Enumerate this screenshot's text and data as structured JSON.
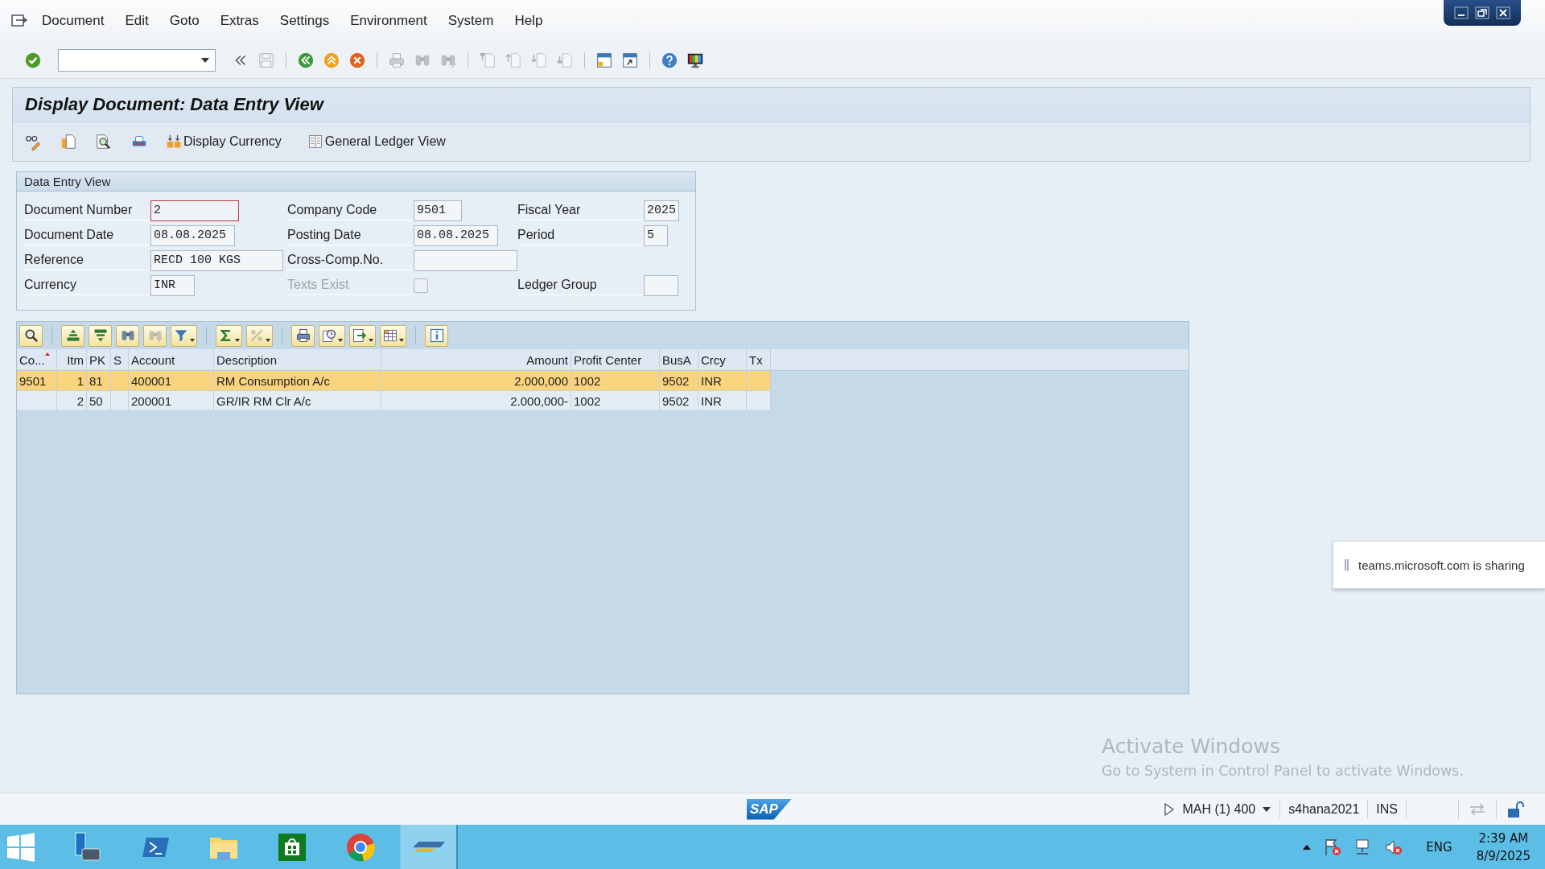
{
  "menu_bar": {
    "items": [
      "Document",
      "Edit",
      "Goto",
      "Extras",
      "Settings",
      "Environment",
      "System",
      "Help"
    ]
  },
  "toolbar": {
    "buttons": [
      {
        "disabled": false
      },
      {
        "disabled": false
      },
      {
        "disabled": true
      },
      {
        "disabled": false
      },
      {
        "disabled": false
      },
      {
        "disabled": false
      },
      {
        "disabled": true
      },
      {
        "disabled": true
      },
      {
        "disabled": true
      },
      {
        "disabled": true
      },
      {
        "disabled": true
      },
      {
        "disabled": true
      },
      {
        "disabled": true
      },
      {
        "disabled": false
      },
      {
        "disabled": false
      },
      {
        "disabled": false
      },
      {
        "disabled": false
      }
    ]
  },
  "screen": {
    "title": "Display Document: Data Entry View",
    "app_toolbar": [
      {
        "label": "Display Currency"
      },
      {
        "label": "General Ledger View"
      }
    ],
    "form": {
      "title": "Data Entry View",
      "rows": [
        [
          {
            "kind": "input",
            "label": "Document Number",
            "value": "2",
            "focused": true
          },
          {
            "kind": "input",
            "label": "Company Code",
            "value": "9501",
            "focused": false
          },
          {
            "kind": "input",
            "label": "Fiscal Year",
            "value": "2025",
            "focused": false
          }
        ],
        [
          {
            "kind": "input",
            "label": "Document Date",
            "value": "08.08.2025",
            "focused": false
          },
          {
            "kind": "input",
            "label": "Posting Date",
            "value": "08.08.2025",
            "focused": false
          },
          {
            "kind": "input",
            "label": "Period",
            "value": "5",
            "focused": false
          }
        ],
        [
          {
            "kind": "input",
            "label": "Reference",
            "value": "RECD 100 KGS",
            "focused": false
          },
          {
            "kind": "input",
            "label": "Cross-Comp.No.",
            "focused": false
          }
        ],
        [
          {
            "kind": "input",
            "label": "Currency",
            "value": "INR",
            "focused": false
          },
          {
            "kind": "checkbox",
            "label": "Texts Exist",
            "checked": false,
            "disabled": true
          },
          {
            "kind": "input",
            "label": "Ledger Group",
            "focused": false
          }
        ]
      ]
    },
    "grid": {
      "toolbar": [
        {
          "disabled": false
        },
        {
          "disabled": false
        },
        {
          "disabled": false
        },
        {
          "disabled": false
        },
        {
          "disabled": true
        },
        {
          "disabled": false
        },
        {
          "disabled": false
        },
        {
          "disabled": true
        },
        {
          "disabled": false
        },
        {
          "disabled": false
        },
        {
          "disabled": false
        },
        {
          "disabled": false
        },
        {
          "disabled": false
        }
      ],
      "columns": [
        {
          "label": "Co...",
          "kind": "text",
          "sorted": true
        },
        {
          "label": "Itm",
          "kind": "number",
          "sorted": false
        },
        {
          "label": "PK",
          "kind": "text",
          "sorted": false
        },
        {
          "label": "S",
          "kind": "text",
          "sorted": false
        },
        {
          "label": "Account",
          "kind": "text",
          "sorted": false
        },
        {
          "label": "Description",
          "kind": "text",
          "sorted": false
        },
        {
          "label": "Amount",
          "kind": "number",
          "sorted": false
        },
        {
          "label": "Profit Center",
          "kind": "text",
          "sorted": false
        },
        {
          "label": "BusA",
          "kind": "text",
          "sorted": false
        },
        {
          "label": "Crcy",
          "kind": "text",
          "sorted": false
        },
        {
          "label": "Tx",
          "kind": "text",
          "sorted": false
        }
      ],
      "rows": [
        {
          "selected": true,
          "cells": [
            "9501",
            "1",
            "81",
            null,
            "400001",
            "RM Consumption A/c",
            "2.000,000",
            "1002",
            "9502",
            "INR",
            null
          ]
        },
        {
          "selected": false,
          "cells": [
            null,
            "2",
            "50",
            null,
            "200001",
            "GR/IR RM Clr A/c",
            "2.000,000-",
            "1002",
            "9502",
            "INR",
            null
          ]
        }
      ]
    }
  },
  "status_bar": {
    "logo": "SAP",
    "session": "MAH (1) 400",
    "system": "s4hana2021",
    "mode": "INS"
  },
  "taskbar": {
    "apps": [
      {
        "active": false
      },
      {
        "active": false
      },
      {
        "active": false
      },
      {
        "active": false
      },
      {
        "active": false
      },
      {
        "active": true
      }
    ],
    "tray": {
      "language": "ENG",
      "time": "2:39 AM",
      "date": "8/9/2025"
    }
  },
  "notification": {
    "text": "teams.microsoft.com is sharing"
  },
  "activation_notice": {
    "title": "Activate Windows",
    "text": "Go to System in Control Panel to activate Windows."
  }
}
